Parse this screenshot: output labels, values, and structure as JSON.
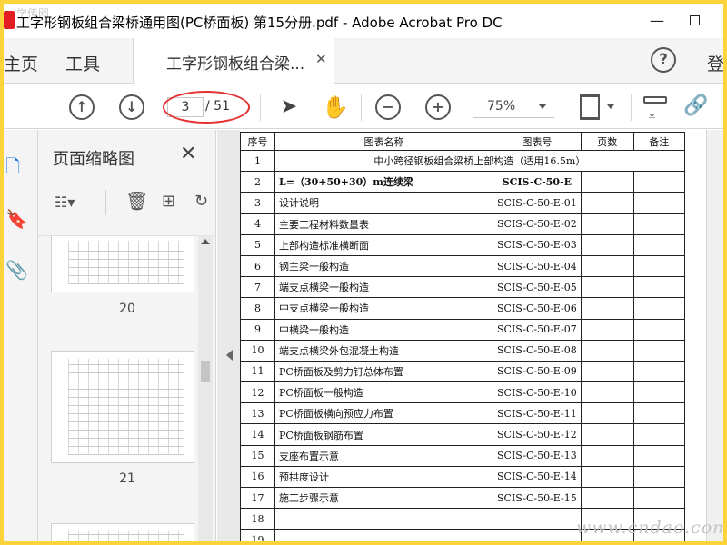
{
  "window": {
    "title": "工字形钢板组合梁桥通用图(PC桥面板) 第15分册.pdf - Adobe Acrobat Pro DC",
    "watermark_top": "学传网",
    "minimize": "—"
  },
  "tabs": {
    "home": "主页",
    "tools": "工具",
    "doc_tab_label": "工字形钢板组合梁...",
    "doc_tab_close": "✕",
    "help": "?",
    "login": "登"
  },
  "toolbar": {
    "page_current": "3",
    "page_total": "/ 51",
    "zoom": "75%"
  },
  "icons": {
    "prev_page": "↑",
    "next_page": "↓",
    "select": "➤",
    "hand": "✋",
    "zoom_out": "−",
    "zoom_in": "+",
    "link": "🔗",
    "pages": "🗋",
    "bookmark": "🔖",
    "attach": "📎",
    "options": "☷▾",
    "trash": "🗑",
    "insert": "⊞",
    "rotate": "↻",
    "read_arrow": "⤓"
  },
  "thumbnail_panel": {
    "title": "页面缩略图",
    "close": "✕",
    "pages": [
      {
        "label": "20"
      },
      {
        "label": "21"
      }
    ]
  },
  "document": {
    "headers": [
      "序号",
      "图表名称",
      "图表号",
      "页数",
      "备注"
    ],
    "section_row": {
      "no": "1",
      "title": "中小跨径钢板组合梁桥上部构造（适用16.5m）"
    },
    "rows": [
      {
        "no": "2",
        "name": "L=（30+50+30）m连续梁",
        "code": "SCIS-C-50-E"
      },
      {
        "no": "3",
        "name": "设计说明",
        "code": "SCIS-C-50-E-01"
      },
      {
        "no": "4",
        "name": "主要工程材料数量表",
        "code": "SCIS-C-50-E-02"
      },
      {
        "no": "5",
        "name": "上部构造标准横断面",
        "code": "SCIS-C-50-E-03"
      },
      {
        "no": "6",
        "name": "钢主梁一般构造",
        "code": "SCIS-C-50-E-04"
      },
      {
        "no": "7",
        "name": "端支点横梁一般构造",
        "code": "SCIS-C-50-E-05"
      },
      {
        "no": "8",
        "name": "中支点横梁一般构造",
        "code": "SCIS-C-50-E-06"
      },
      {
        "no": "9",
        "name": "中横梁一般构造",
        "code": "SCIS-C-50-E-07"
      },
      {
        "no": "10",
        "name": "端支点横梁外包混凝土构造",
        "code": "SCIS-C-50-E-08"
      },
      {
        "no": "11",
        "name": "PC桥面板及剪力钉总体布置",
        "code": "SCIS-C-50-E-09"
      },
      {
        "no": "12",
        "name": "PC桥面板一般构造",
        "code": "SCIS-C-50-E-10"
      },
      {
        "no": "13",
        "name": "PC桥面板横向预应力布置",
        "code": "SCIS-C-50-E-11"
      },
      {
        "no": "14",
        "name": "PC桥面板钢筋布置",
        "code": "SCIS-C-50-E-12"
      },
      {
        "no": "15",
        "name": "支座布置示意",
        "code": "SCIS-C-50-E-13"
      },
      {
        "no": "16",
        "name": "预拱度设计",
        "code": "SCIS-C-50-E-14"
      },
      {
        "no": "17",
        "name": "施工步骤示意",
        "code": "SCIS-C-50-E-15"
      },
      {
        "no": "18",
        "name": "",
        "code": ""
      },
      {
        "no": "19",
        "name": "",
        "code": ""
      }
    ]
  },
  "watermark_bottom": "www.cndao.com",
  "colors": {
    "frame": "#fbd33a",
    "accent": "#1473e6",
    "annotation": "#e53030"
  }
}
